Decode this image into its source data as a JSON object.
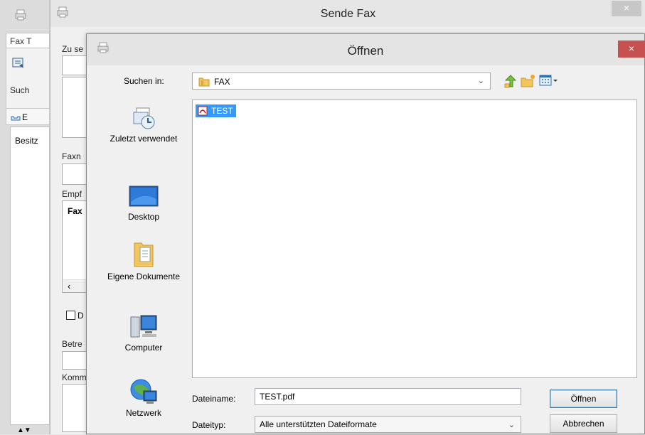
{
  "bg_app": {
    "tab_label": "Fax T",
    "search_label": "Such",
    "bar_label": "E",
    "list_label": "Besitz"
  },
  "fax_window": {
    "title": "Sende Fax",
    "close_glyph": "×",
    "labels": {
      "to": "Zu se",
      "faxnum": "Faxn",
      "recipients": "Empf",
      "fax_col": "Fax",
      "checkbox": "D",
      "subject": "Betre",
      "comment": "Komm"
    },
    "scroll_left": "‹"
  },
  "open_dialog": {
    "title": "Öffnen",
    "close_glyph": "×",
    "look_in_label": "Suchen in:",
    "look_in_value": "FAX",
    "places": [
      {
        "label": "Zuletzt verwendet"
      },
      {
        "label": "Desktop"
      },
      {
        "label": "Eigene Dokumente"
      },
      {
        "label": "Computer"
      },
      {
        "label": "Netzwerk"
      }
    ],
    "files": [
      {
        "name": "TEST",
        "selected": true
      }
    ],
    "filename_label": "Dateiname:",
    "filename_value": "TEST.pdf",
    "filetype_label": "Dateityp:",
    "filetype_value": "Alle unterstützten Dateiformate",
    "open_button": "Öffnen",
    "cancel_button": "Abbrechen"
  },
  "colors": {
    "selection": "#3399ff",
    "close_active": "#c75050",
    "close_inactive": "#c7c7c7"
  }
}
